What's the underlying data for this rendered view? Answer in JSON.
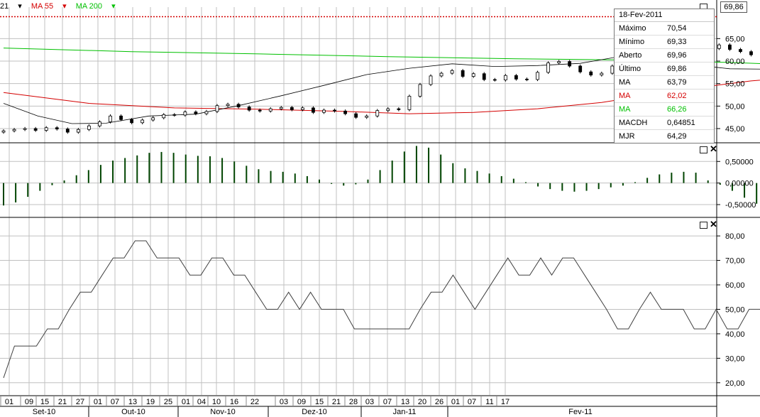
{
  "legend": [
    {
      "label": "21",
      "color": "#000000"
    },
    {
      "label": "MA 55",
      "color": "#d40000"
    },
    {
      "label": "MA 200",
      "color": "#00c000"
    }
  ],
  "last_price_flag": "69,86",
  "info": {
    "date": "18-Fev-2011",
    "rows": [
      {
        "label": "Máximo",
        "value": "70,54",
        "color": "#000000"
      },
      {
        "label": "Mínimo",
        "value": "69,33",
        "color": "#000000"
      },
      {
        "label": "Aberto",
        "value": "69,96",
        "color": "#000000"
      },
      {
        "label": "Último",
        "value": "69,86",
        "color": "#000000"
      },
      {
        "label": "MA",
        "value": "63,79",
        "color": "#000000"
      },
      {
        "label": "MA",
        "value": "62,02",
        "color": "#d40000"
      },
      {
        "label": "MA",
        "value": "66,26",
        "color": "#00c000"
      },
      {
        "label": "MACDH",
        "value": "0,64851",
        "color": "#000000"
      },
      {
        "label": "MJR",
        "value": "64,29",
        "color": "#000000"
      }
    ]
  },
  "colors": {
    "ma21": "#000000",
    "ma55": "#d40000",
    "ma200": "#00c000",
    "macd": "#004400",
    "line": "#404040",
    "grid": "#c0c0c0",
    "price_line": "#d40000"
  },
  "chart_data": [
    {
      "type": "candlestick",
      "panel": "price",
      "ylim": [
        42,
        72
      ],
      "yticks": [
        "45,00",
        "50,00",
        "55,00",
        "60,00",
        "65,00"
      ],
      "ytick_values": [
        45,
        50,
        55,
        60,
        65
      ],
      "x_day_ticks": [
        "01",
        "09",
        "15",
        "21",
        "27",
        "01",
        "07",
        "13",
        "19",
        "25",
        "01",
        "04",
        "10",
        "16",
        "22",
        "03",
        "09",
        "15",
        "21",
        "28",
        "03",
        "07",
        "13",
        "20",
        "26",
        "01",
        "07",
        "11",
        "17"
      ],
      "x_months": [
        "Set-10",
        "Out-10",
        "Nov-10",
        "Dez-10",
        "Jan-11",
        "Fev-11"
      ],
      "close": [
        44.5,
        44.8,
        45.0,
        44.6,
        45.2,
        44.9,
        44.2,
        44.8,
        45.6,
        46.5,
        47.8,
        47.0,
        46.3,
        46.9,
        47.4,
        48.1,
        48.0,
        48.7,
        48.3,
        48.8,
        50.1,
        50.4,
        49.8,
        49.1,
        48.9,
        49.4,
        49.7,
        49.2,
        49.6,
        48.6,
        49.1,
        48.9,
        48.3,
        47.5,
        47.8,
        49.0,
        49.4,
        49.2,
        52.2,
        54.8,
        56.7,
        57.3,
        57.9,
        56.6,
        57.2,
        55.9,
        55.8,
        56.8,
        56.0,
        55.9,
        57.5,
        59.6,
        59.9,
        58.9,
        57.6,
        56.9,
        57.3,
        58.9,
        59.4,
        60.2,
        59.8,
        59.7,
        60.5,
        61.4,
        63.5,
        63.2,
        62.8,
        63.6,
        62.6,
        62.1,
        61.4,
        61.8,
        61.5,
        60.9,
        59.9,
        59.1,
        58.4,
        58.6,
        58.8,
        58.9,
        58.6,
        58.2,
        58.5,
        58.7,
        58.0,
        59.3,
        60.5,
        61.4,
        62.1,
        62.5,
        62.8,
        64.4,
        65.2,
        65.9,
        64.3,
        63.8,
        61.9,
        61.5,
        61.9,
        61.7,
        61.1,
        61.3,
        60.1,
        59.3,
        58.8,
        59.4,
        61.2,
        62.8,
        64.4,
        63.9,
        63.5,
        66.3,
        67.0,
        66.1,
        65.2,
        67.9,
        69.86
      ]
    },
    {
      "type": "line",
      "panel": "price",
      "name": "MA 21",
      "points": [
        [
          0,
          50.6
        ],
        [
          8,
          47.8
        ],
        [
          16,
          46.1
        ],
        [
          24,
          46.2
        ],
        [
          34,
          47.8
        ],
        [
          45,
          48.2
        ],
        [
          55,
          50.1
        ],
        [
          65,
          52.3
        ],
        [
          75,
          54.6
        ],
        [
          85,
          57.0
        ],
        [
          95,
          58.4
        ],
        [
          105,
          59.4
        ],
        [
          115,
          58.8
        ],
        [
          125,
          59.0
        ],
        [
          135,
          59.5
        ],
        [
          143,
          60.8
        ],
        [
          150,
          60.8
        ],
        [
          160,
          59.3
        ],
        [
          170,
          58.3
        ],
        [
          180,
          58.2
        ],
        [
          190,
          58.7
        ],
        [
          198,
          60.5
        ],
        [
          205,
          61.0
        ],
        [
          213,
          61.4
        ],
        [
          225,
          61.2
        ],
        [
          236,
          61.0
        ],
        [
          247,
          61.3
        ],
        [
          260,
          61.7
        ],
        [
          270,
          62.2
        ],
        [
          281,
          62.7
        ],
        [
          290,
          63.8
        ]
      ]
    },
    {
      "type": "line",
      "panel": "price",
      "name": "MA 55",
      "points": [
        [
          0,
          53.0
        ],
        [
          20,
          50.6
        ],
        [
          40,
          49.6
        ],
        [
          60,
          49.3
        ],
        [
          80,
          48.8
        ],
        [
          95,
          48.3
        ],
        [
          110,
          48.6
        ],
        [
          125,
          49.4
        ],
        [
          140,
          50.8
        ],
        [
          160,
          53.8
        ],
        [
          175,
          55.6
        ],
        [
          190,
          56.8
        ],
        [
          210,
          58.0
        ],
        [
          230,
          59.0
        ],
        [
          250,
          60.0
        ],
        [
          270,
          61.0
        ],
        [
          290,
          62.0
        ]
      ]
    },
    {
      "type": "line",
      "panel": "price",
      "name": "MA 200",
      "points": [
        [
          0,
          62.9
        ],
        [
          30,
          62.1
        ],
        [
          60,
          61.6
        ],
        [
          90,
          61.0
        ],
        [
          120,
          60.5
        ],
        [
          150,
          60.2
        ],
        [
          170,
          59.7
        ],
        [
          200,
          58.6
        ],
        [
          230,
          57.3
        ],
        [
          260,
          56.4
        ],
        [
          275,
          56.2
        ],
        [
          290,
          56.2
        ]
      ]
    },
    {
      "type": "bar",
      "panel": "macd",
      "name": "MACDH",
      "ylim": [
        -0.78,
        0.9
      ],
      "yticks": [
        "-0,50000",
        "0,00000",
        "0,50000"
      ],
      "ytick_values": [
        -0.5,
        0,
        0.5
      ],
      "values": [
        -0.52,
        -0.45,
        -0.32,
        -0.18,
        -0.05,
        0.06,
        0.18,
        0.3,
        0.42,
        0.52,
        0.58,
        0.64,
        0.7,
        0.72,
        0.7,
        0.66,
        0.63,
        0.62,
        0.58,
        0.5,
        0.4,
        0.32,
        0.28,
        0.26,
        0.22,
        0.16,
        0.08,
        -0.02,
        -0.06,
        -0.03,
        0.08,
        0.3,
        0.52,
        0.73,
        0.86,
        0.82,
        0.66,
        0.46,
        0.34,
        0.28,
        0.22,
        0.16,
        0.1,
        0.02,
        -0.08,
        -0.14,
        -0.18,
        -0.2,
        -0.18,
        -0.14,
        -0.1,
        -0.06,
        0.02,
        0.12,
        0.2,
        0.24,
        0.26,
        0.24,
        0.06,
        -0.04,
        -0.18,
        -0.34,
        -0.48,
        -0.58,
        -0.62,
        -0.6,
        -0.55,
        -0.48,
        -0.4,
        -0.32,
        -0.22,
        -0.12,
        0.02,
        0.12,
        0.22,
        0.3,
        0.36,
        0.42,
        0.48,
        0.52,
        0.53,
        0.52,
        0.42,
        0.18,
        0.02,
        -0.06,
        -0.12,
        -0.2,
        -0.3,
        -0.44,
        -0.48,
        -0.36,
        -0.16,
        -0.06,
        0.04,
        0.14,
        0.3,
        0.42,
        0.44,
        0.38,
        0.5,
        0.62,
        0.65
      ]
    },
    {
      "type": "line",
      "panel": "oscillator",
      "name": "MJR",
      "ylim": [
        15,
        87
      ],
      "yticks": [
        "20,00",
        "30,00",
        "40,00",
        "50,00",
        "60,00",
        "70,00",
        "80,00"
      ],
      "ytick_values": [
        20,
        30,
        40,
        50,
        60,
        70,
        80
      ],
      "values": [
        22,
        35,
        35,
        35,
        42,
        42,
        50,
        57,
        57,
        64,
        71,
        71,
        78,
        78,
        71,
        71,
        71,
        64,
        64,
        71,
        71,
        64,
        64,
        57,
        50,
        50,
        57,
        50,
        57,
        50,
        50,
        50,
        42,
        42,
        42,
        42,
        42,
        42,
        50,
        57,
        57,
        64,
        57,
        50,
        57,
        64,
        71,
        64,
        64,
        71,
        64,
        71,
        71,
        64,
        57,
        50,
        42,
        42,
        50,
        57,
        50,
        50,
        50,
        42,
        42,
        50,
        42,
        42,
        50,
        50,
        42,
        35,
        28,
        35,
        42,
        42,
        35,
        35,
        35,
        28,
        28,
        35,
        35,
        35,
        42,
        50,
        57,
        50,
        50,
        57,
        64,
        71,
        71,
        78,
        85,
        78,
        71,
        71,
        64,
        64,
        57,
        50,
        50,
        50,
        50,
        42,
        50,
        50,
        57,
        50,
        50,
        42,
        50,
        64
      ]
    }
  ]
}
